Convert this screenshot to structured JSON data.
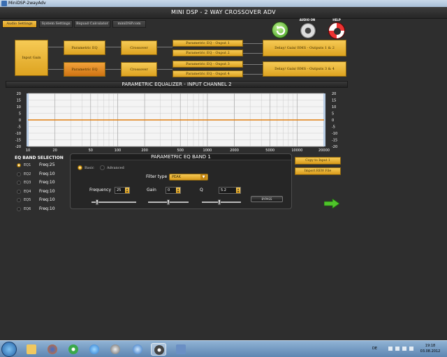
{
  "window": {
    "title": "MiniDSP-2wayAdv"
  },
  "app": {
    "title": "MINI DSP - 2 WAY CROSSOVER ADV"
  },
  "menu": [
    "Audio Settings",
    "System Settings",
    "Biquad Calculator",
    "miniDSP.com"
  ],
  "top_icons": {
    "audio_on": "AUDIO ON",
    "help": "HELP"
  },
  "routing": {
    "input_gain": "Input Gain",
    "peq1": "Parametric EQ",
    "peq2": "Parametric EQ",
    "crossover1": "Crossover",
    "crossover2": "Crossover",
    "outputs": [
      "Parametric EQ - Ouput 1",
      "Parametric EQ - Ouput 2",
      "Parametric EQ - Ouput 3",
      "Parametric EQ - Ouput 4"
    ],
    "delay1": "Delay/ Gain/ RMS - Outputs 1 & 2",
    "delay2": "Delay/ Gain/ RMS - Outputs 3 & 4"
  },
  "peq": {
    "title": "PARAMETRIC EQUALIZER - INPUT CHANNEL 2"
  },
  "chart_data": {
    "type": "line",
    "x_ticks": [
      10,
      20,
      50,
      100,
      200,
      500,
      1000,
      2000,
      5000,
      10000,
      20000
    ],
    "y_ticks": [
      20,
      15,
      10,
      5,
      0,
      -5,
      -10,
      -15,
      -20
    ],
    "xlim": [
      10,
      20000
    ],
    "ylim": [
      -20,
      20
    ],
    "x_scale": "log",
    "grid": true,
    "series": [
      {
        "x": [
          10,
          20000
        ],
        "y": [
          0,
          0
        ]
      }
    ]
  },
  "bands": {
    "title": "EQ BAND SELECTION",
    "items": [
      {
        "name": "EQ1",
        "freq": "Freq:25"
      },
      {
        "name": "EQ2",
        "freq": "Freq:10"
      },
      {
        "name": "EQ3",
        "freq": "Freq:10"
      },
      {
        "name": "EQ4",
        "freq": "Freq:10"
      },
      {
        "name": "EQ5",
        "freq": "Freq:10"
      },
      {
        "name": "EQ6",
        "freq": "Freq:10"
      }
    ]
  },
  "band_panel": {
    "title": "PARAMETRIC EQ BAND 1",
    "mode_basic": "Basic",
    "mode_advanced": "Advanced",
    "filter_type_label": "Filter type",
    "filter_type": "PEAK",
    "frequency_label": "Frequency",
    "frequency": "25",
    "gain_label": "Gain",
    "gain": "0",
    "q_label": "Q",
    "q": "5.2",
    "bypass": "BYPASS",
    "slider_frequency_level": 0.12,
    "slider_gain_level": 0.5,
    "slider_q_level": 0.45
  },
  "side_buttons": {
    "copy": "Copy to Input 1",
    "import": "Import REW File"
  },
  "taskbar": {
    "lang": "DE",
    "time": "19:18",
    "date": "03.08.2012"
  }
}
